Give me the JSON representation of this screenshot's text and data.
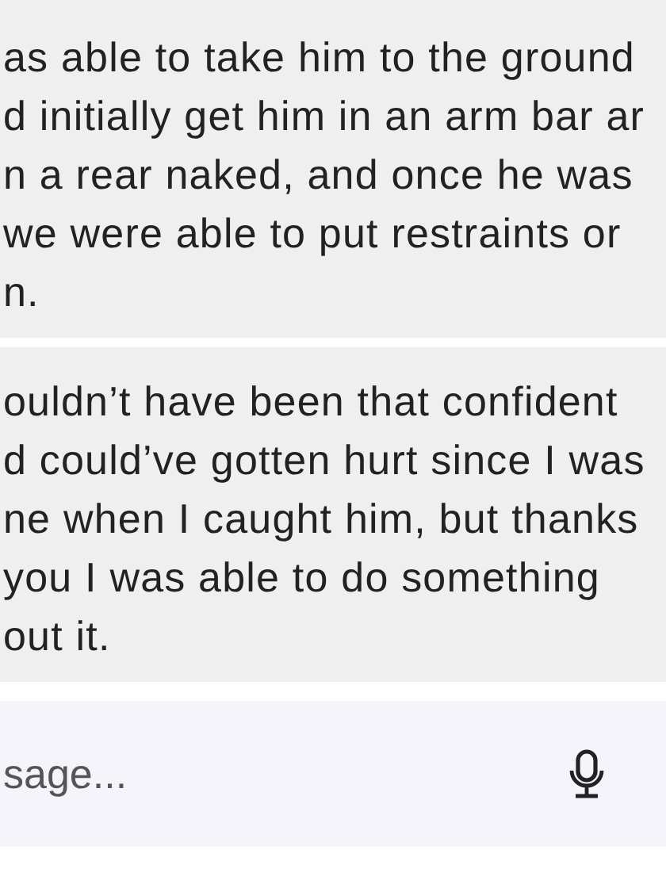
{
  "messages": [
    {
      "lines": [
        "as able to take him to the ground",
        "d initially get him in an arm bar ar",
        "n a rear naked, and once he was",
        "we were able to put restraints or",
        "n."
      ]
    },
    {
      "lines": [
        "ouldn’t have been that confident",
        "d could’ve gotten hurt since I was",
        "ne when I caught him, but thanks",
        "you I was able to do something",
        "out it."
      ]
    }
  ],
  "composer": {
    "placeholder": "sage..."
  }
}
